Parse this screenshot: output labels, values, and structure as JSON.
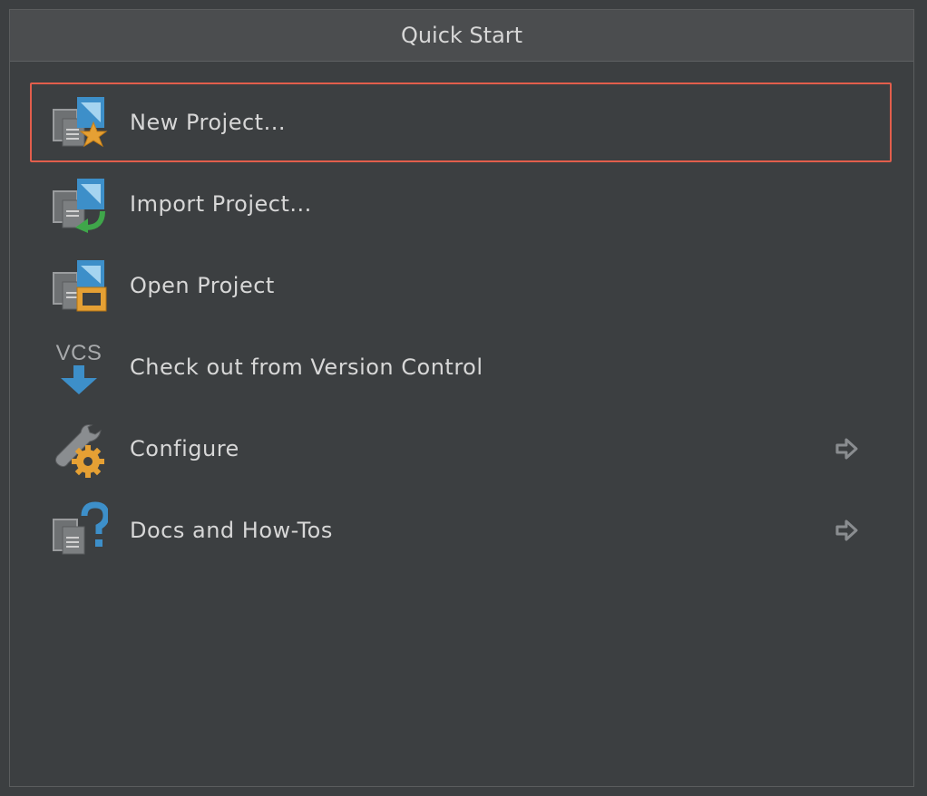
{
  "window": {
    "title": "Quick Start"
  },
  "items": [
    {
      "label": "New Project...",
      "icon": "new-project-icon",
      "selected": true,
      "has_submenu": false
    },
    {
      "label": "Import Project...",
      "icon": "import-project-icon",
      "selected": false,
      "has_submenu": false
    },
    {
      "label": "Open Project",
      "icon": "open-project-icon",
      "selected": false,
      "has_submenu": false
    },
    {
      "label": "Check out from Version Control",
      "icon": "vcs-checkout-icon",
      "selected": false,
      "has_submenu": false
    },
    {
      "label": "Configure",
      "icon": "configure-icon",
      "selected": false,
      "has_submenu": true
    },
    {
      "label": "Docs and How-Tos",
      "icon": "docs-icon",
      "selected": false,
      "has_submenu": true
    }
  ],
  "colors": {
    "background": "#3c3f41",
    "header_background": "#4b4d4f",
    "text": "#d7d7d7",
    "selection_border": "#e25e4c",
    "accent_blue": "#3d8fc9",
    "accent_orange": "#e5a034",
    "accent_green": "#3fa64a"
  }
}
